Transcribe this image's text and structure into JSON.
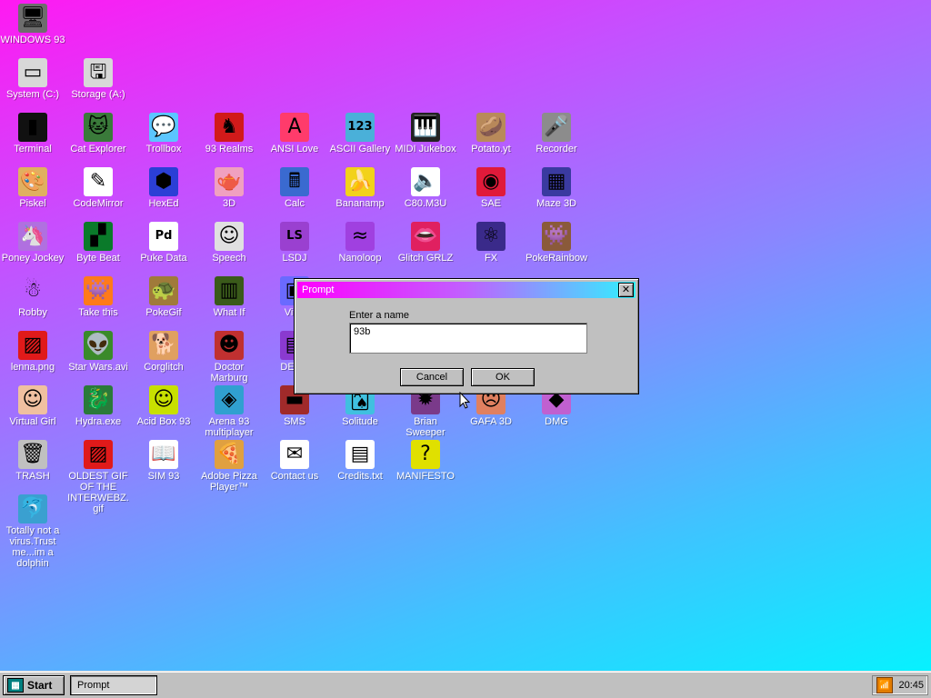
{
  "desktop": {
    "icons": [
      {
        "id": "windows93",
        "label": "WINDOWS 93",
        "glyph": "🖥",
        "bg": "#6d6d6d",
        "col": 0,
        "row": 0
      },
      {
        "id": "system-c",
        "label": "System (C:)",
        "glyph": "▭",
        "bg": "#d8d8d8",
        "col": 0,
        "row": 1
      },
      {
        "id": "storage-a",
        "label": "Storage (A:)",
        "glyph": "🖫",
        "bg": "#d8d8d8",
        "col": 1,
        "row": 1
      },
      {
        "id": "terminal",
        "label": "Terminal",
        "glyph": "▮",
        "bg": "#111111",
        "col": 0,
        "row": 2
      },
      {
        "id": "cat-explorer",
        "label": "Cat Explorer",
        "glyph": "🐱",
        "bg": "#3a7a3a",
        "col": 1,
        "row": 2
      },
      {
        "id": "trollbox",
        "label": "Trollbox",
        "glyph": "💬",
        "bg": "#5bc6ff",
        "col": 2,
        "row": 2
      },
      {
        "id": "93-realms",
        "label": "93 Realms",
        "glyph": "♞",
        "bg": "#d11a1a",
        "col": 3,
        "row": 2
      },
      {
        "id": "ansi-love",
        "label": "ANSI Love",
        "glyph": "A",
        "bg": "#ff3b6b",
        "col": 4,
        "row": 2
      },
      {
        "id": "ascii-gallery",
        "label": "ASCII Gallery",
        "glyph": "123",
        "bg": "#4ab0d9",
        "col": 5,
        "row": 2
      },
      {
        "id": "midi-jukebox",
        "label": "MIDI Jukebox",
        "glyph": "🎹",
        "bg": "#222222",
        "col": 6,
        "row": 2
      },
      {
        "id": "potato-yt",
        "label": "Potato.yt",
        "glyph": "🥔",
        "bg": "#b88a5a",
        "col": 7,
        "row": 2
      },
      {
        "id": "recorder",
        "label": "Recorder",
        "glyph": "🎤",
        "bg": "#8c8c8c",
        "col": 8,
        "row": 2
      },
      {
        "id": "piskel",
        "label": "Piskel",
        "glyph": "🎨",
        "bg": "#e0b060",
        "col": 0,
        "row": 3
      },
      {
        "id": "codemirror",
        "label": "CodeMirror",
        "glyph": "✎",
        "bg": "#ffffff",
        "col": 1,
        "row": 3
      },
      {
        "id": "hexed",
        "label": "HexEd",
        "glyph": "⬢",
        "bg": "#2b3fd6",
        "col": 2,
        "row": 3
      },
      {
        "id": "3d",
        "label": "3D",
        "glyph": "🫖",
        "bg": "#f0a0c0",
        "col": 3,
        "row": 3
      },
      {
        "id": "calc",
        "label": "Calc",
        "glyph": "🖩",
        "bg": "#3a6ad0",
        "col": 4,
        "row": 3
      },
      {
        "id": "bananamp",
        "label": "Bananamp",
        "glyph": "🍌",
        "bg": "#f2d21a",
        "col": 5,
        "row": 3
      },
      {
        "id": "c80-m3u",
        "label": "C80.M3U",
        "glyph": "🔈",
        "bg": "#ffffff",
        "col": 6,
        "row": 3
      },
      {
        "id": "sae",
        "label": "SAE",
        "glyph": "◉",
        "bg": "#e01a3a",
        "col": 7,
        "row": 3
      },
      {
        "id": "maze-3d",
        "label": "Maze 3D",
        "glyph": "▦",
        "bg": "#3a3aa0",
        "col": 8,
        "row": 3
      },
      {
        "id": "poney-jockey",
        "label": "Poney Jockey",
        "glyph": "🦄",
        "bg": "#b070e0",
        "col": 0,
        "row": 4
      },
      {
        "id": "byte-beat",
        "label": "Byte Beat",
        "glyph": "▞",
        "bg": "#0a7a2a",
        "col": 1,
        "row": 4
      },
      {
        "id": "puke-data",
        "label": "Puke Data",
        "glyph": "Pd",
        "bg": "#ffffff",
        "col": 2,
        "row": 4
      },
      {
        "id": "speech",
        "label": "Speech",
        "glyph": "☺",
        "bg": "#e0e0e0",
        "col": 3,
        "row": 4
      },
      {
        "id": "lsdj",
        "label": "LSDJ",
        "glyph": "LS",
        "bg": "#9a40d0",
        "col": 4,
        "row": 4
      },
      {
        "id": "nanoloop",
        "label": "Nanoloop",
        "glyph": "≈",
        "bg": "#a040e0",
        "col": 5,
        "row": 4
      },
      {
        "id": "glitch-grlz",
        "label": "Glitch GRLZ",
        "glyph": "👄",
        "bg": "#e02060",
        "col": 6,
        "row": 4
      },
      {
        "id": "fx",
        "label": "FX",
        "glyph": "⚛",
        "bg": "#3a2a8a",
        "col": 7,
        "row": 4
      },
      {
        "id": "pokerainbow",
        "label": "PokeRainbow",
        "glyph": "👾",
        "bg": "#8a5a3a",
        "col": 8,
        "row": 4
      },
      {
        "id": "robby",
        "label": "Robby",
        "glyph": "☃",
        "bg": "transparent",
        "col": 0,
        "row": 5
      },
      {
        "id": "take-this",
        "label": "Take this",
        "glyph": "👾",
        "bg": "#ff7a1a",
        "col": 1,
        "row": 5
      },
      {
        "id": "pokegif",
        "label": "PokeGif",
        "glyph": "🐢",
        "bg": "#a07a3a",
        "col": 2,
        "row": 5
      },
      {
        "id": "what-if",
        "label": "What If",
        "glyph": "▥",
        "bg": "#3a5a1a",
        "col": 3,
        "row": 5
      },
      {
        "id": "virtual",
        "label": "Virtu",
        "glyph": "▣",
        "bg": "#6a6aff",
        "col": 4,
        "row": 5
      },
      {
        "id": "lenna-png",
        "label": "lenna.png",
        "glyph": "▨",
        "bg": "#e01a1a",
        "col": 0,
        "row": 6
      },
      {
        "id": "star-wars-avi",
        "label": "Star Wars.avi",
        "glyph": "👽",
        "bg": "#3a8a2a",
        "col": 1,
        "row": 6
      },
      {
        "id": "corglitch",
        "label": "Corglitch",
        "glyph": "🐕",
        "bg": "#e0a060",
        "col": 2,
        "row": 6
      },
      {
        "id": "doctor-marburg",
        "label": "Doctor Marburg",
        "glyph": "☻",
        "bg": "#c03030",
        "col": 3,
        "row": 6
      },
      {
        "id": "derc",
        "label": "DERC",
        "glyph": "▤",
        "bg": "#8a3ad0",
        "col": 4,
        "row": 6
      },
      {
        "id": "virtual-girl",
        "label": "Virtual Girl",
        "glyph": "☺",
        "bg": "#f0c0a0",
        "col": 0,
        "row": 7
      },
      {
        "id": "hydra-exe",
        "label": "Hydra.exe",
        "glyph": "🐉",
        "bg": "#2a7a3a",
        "col": 1,
        "row": 7
      },
      {
        "id": "acid-box-93",
        "label": "Acid Box 93",
        "glyph": "☺",
        "bg": "#c8e000",
        "col": 2,
        "row": 7
      },
      {
        "id": "arena-93",
        "label": "Arena 93 multiplayer",
        "glyph": "◈",
        "bg": "#30a0d0",
        "col": 3,
        "row": 7
      },
      {
        "id": "sms",
        "label": "SMS",
        "glyph": "▬",
        "bg": "#a02a2a",
        "col": 4,
        "row": 7
      },
      {
        "id": "solitude",
        "label": "Solitude",
        "glyph": "🂡",
        "bg": "#40c0e0",
        "col": 5,
        "row": 7
      },
      {
        "id": "brian-sweeper",
        "label": "Brian Sweeper",
        "glyph": "✹",
        "bg": "#7a3a8a",
        "col": 6,
        "row": 7
      },
      {
        "id": "gafa-3d",
        "label": "GAFA 3D",
        "glyph": "☹",
        "bg": "#e08060",
        "col": 7,
        "row": 7
      },
      {
        "id": "dmg",
        "label": "DMG",
        "glyph": "◆",
        "bg": "#c060d0",
        "col": 8,
        "row": 7
      },
      {
        "id": "trash",
        "label": "TRASH",
        "glyph": "🗑",
        "bg": "#c0c0c0",
        "col": 0,
        "row": 8
      },
      {
        "id": "oldest-gif",
        "label": "OLDEST GIF OF THE INTERWEBZ.gif",
        "glyph": "▨",
        "bg": "#e01a1a",
        "col": 1,
        "row": 8
      },
      {
        "id": "sim-93",
        "label": "SIM 93",
        "glyph": "📖",
        "bg": "#ffffff",
        "col": 2,
        "row": 8
      },
      {
        "id": "adobe-pizza",
        "label": "Adobe Pizza Player™",
        "glyph": "🍕",
        "bg": "#e0a040",
        "col": 3,
        "row": 8
      },
      {
        "id": "contact-us",
        "label": "Contact us",
        "glyph": "✉",
        "bg": "#ffffff",
        "col": 4,
        "row": 8
      },
      {
        "id": "credits-txt",
        "label": "Credits.txt",
        "glyph": "▤",
        "bg": "#ffffff",
        "col": 5,
        "row": 8
      },
      {
        "id": "manifesto",
        "label": "MANIFESTO",
        "glyph": "?",
        "bg": "#e0e000",
        "col": 6,
        "row": 8
      },
      {
        "id": "dolphin",
        "label": "Totally not a virus.Trust me...im a dolphin",
        "glyph": "🐬",
        "bg": "#3aa0d0",
        "col": 0,
        "row": 9
      }
    ]
  },
  "dialog": {
    "title": "Prompt",
    "close_glyph": "✕",
    "label": "Enter a name",
    "input_value": "93b",
    "cancel_label": "Cancel",
    "ok_label": "OK"
  },
  "taskbar": {
    "start_label": "Start",
    "start_icon": "▦",
    "task_label": "Prompt",
    "tray_icon": "📶",
    "clock": "20:45"
  }
}
